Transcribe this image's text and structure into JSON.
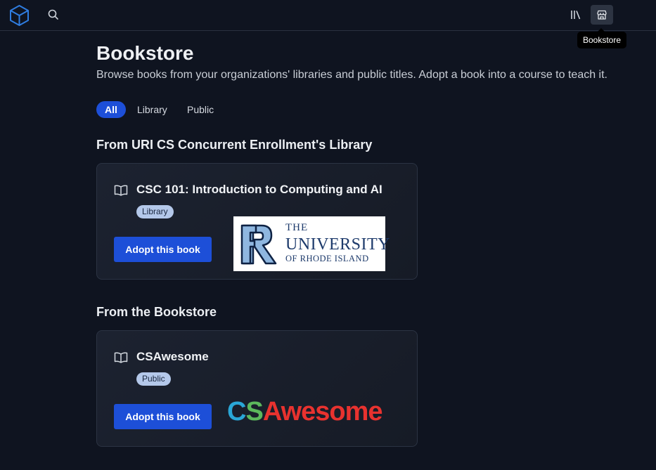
{
  "topbar": {
    "logo_icon": "cube-logo-icon",
    "search_icon": "search-icon",
    "library_icon": "library-books-icon",
    "bookstore_icon": "storefront-icon",
    "tooltip": "Bookstore"
  },
  "page": {
    "title": "Bookstore",
    "subtitle": "Browse books from your organizations' libraries and public titles. Adopt a book into a course to teach it."
  },
  "filters": [
    {
      "label": "All",
      "active": true
    },
    {
      "label": "Library",
      "active": false
    },
    {
      "label": "Public",
      "active": false
    }
  ],
  "sections": [
    {
      "title": "From URI CS Concurrent Enrollment's Library",
      "book": {
        "title": "CSC 101: Introduction to Computing and AI",
        "badge": "Library",
        "button": "Adopt this book",
        "logo": {
          "line1": "THE",
          "line2": "UNIVERSITY",
          "line3": "OF RHODE ISLAND"
        }
      }
    },
    {
      "title": "From the Bookstore",
      "book": {
        "title": "CSAwesome",
        "badge": "Public",
        "button": "Adopt this book",
        "logo": {
          "part_c": "C",
          "part_s": "S",
          "part_a": "A",
          "part_rest": "wesome"
        }
      }
    }
  ],
  "colors": {
    "background": "#0f1420",
    "accent": "#1d4fd8",
    "badge_bg": "#b4c8ea",
    "card_bg": "#1a1f2c"
  }
}
